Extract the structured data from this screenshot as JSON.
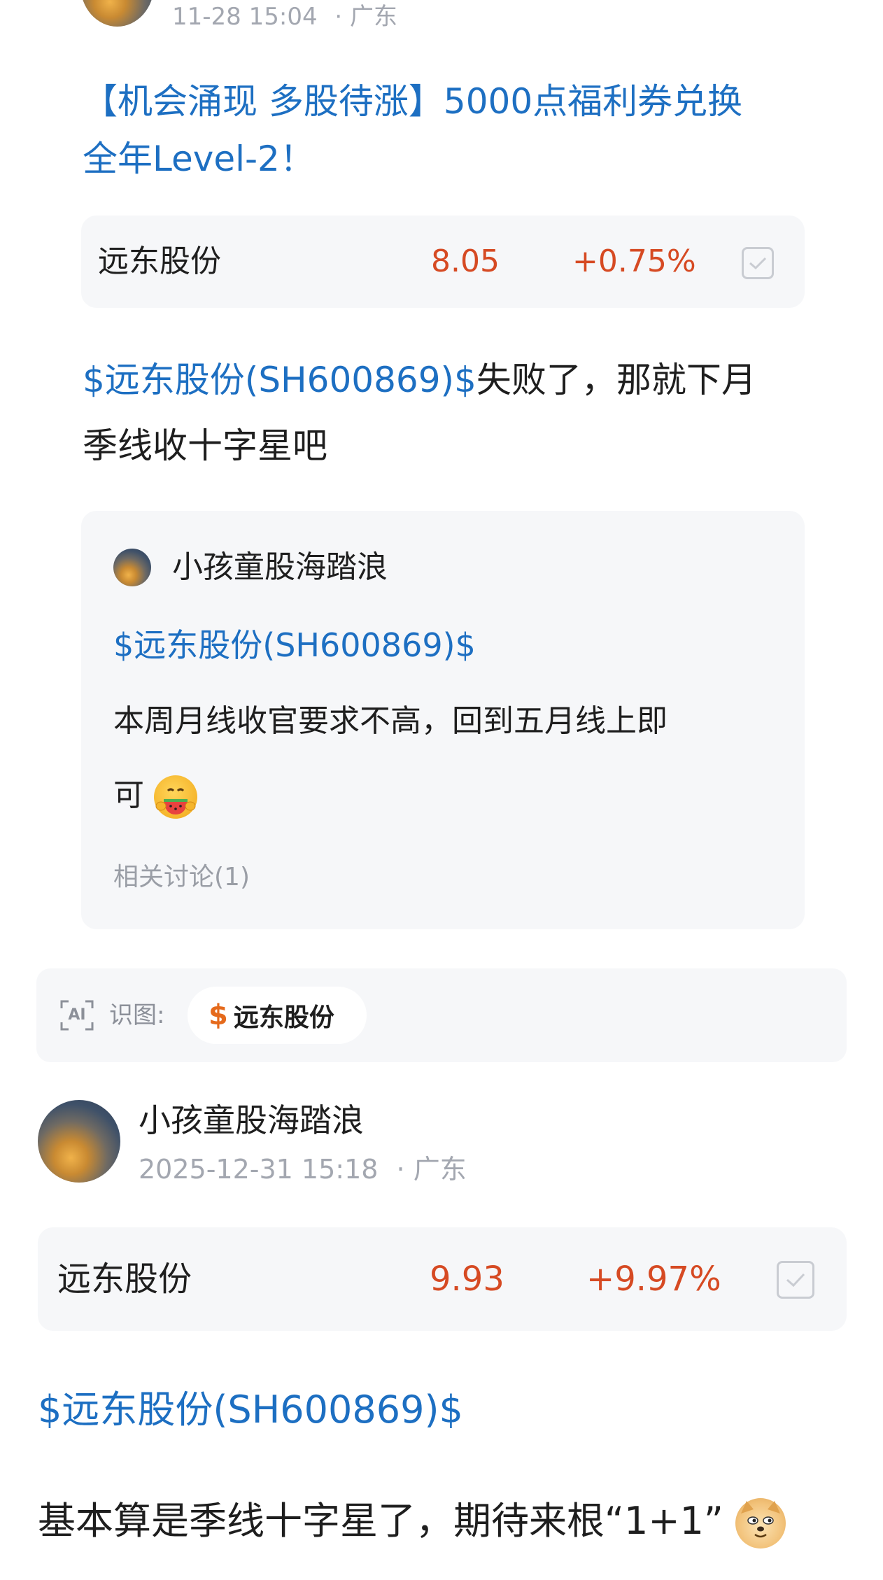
{
  "post1": {
    "time": "11-28 15:04",
    "location": "· 广东",
    "title_line1": "【机会涌现 多股待涨】5000点福利券兑换",
    "title_line2": "全年Level-2！",
    "stock": {
      "name": "远东股份",
      "price": "8.05",
      "change": "+0.75%"
    },
    "body_link": "$远东股份(SH600869)$",
    "body_text_1": "失败了，那就下月",
    "body_text_2": "季线收十字星吧",
    "quote": {
      "author": "小孩童股海踏浪",
      "link": "$远东股份(SH600869)$",
      "text_1": "本周月线收官要求不高，回到五月线上即",
      "text_2": "可",
      "emoji": "watermelon-face",
      "related": "相关讨论(1)"
    }
  },
  "ai_bar": {
    "ai_label": "AI",
    "label": "识图:",
    "chip_symbol": "$",
    "chip_text": "远东股份"
  },
  "post2": {
    "author": "小孩童股海踏浪",
    "time": "2025-12-31 15:18",
    "location": "· 广东",
    "stock": {
      "name": "远东股份",
      "price": "9.93",
      "change": "+9.97%"
    },
    "body_link": "$远东股份(SH600869)$",
    "body_text": "基本算是季线十字星了，期待来根“1+1”",
    "emoji": "doge"
  },
  "colors": {
    "link": "#1d6fc2",
    "price_up": "#d64a23",
    "meta_gray": "#a3a7b0",
    "card_bg": "#f6f7f9"
  }
}
